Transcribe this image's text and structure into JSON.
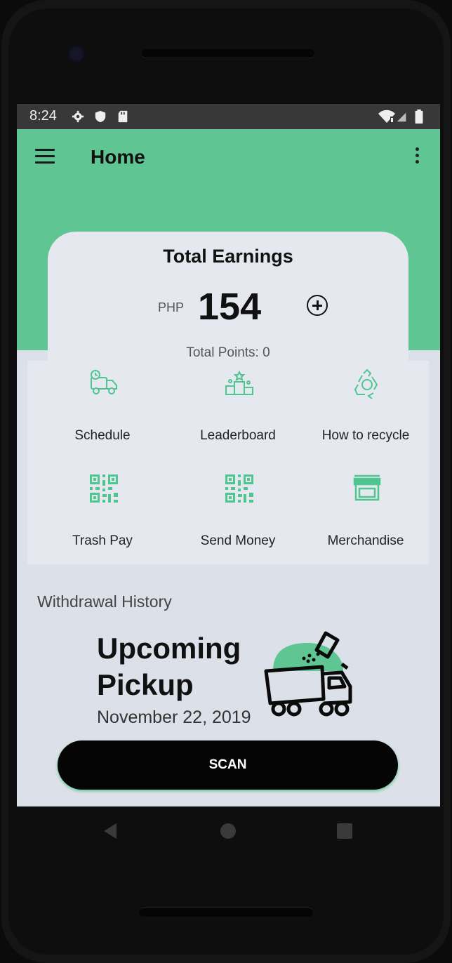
{
  "status_bar": {
    "time": "8:24"
  },
  "app_bar": {
    "title": "Home"
  },
  "earnings": {
    "title": "Total Earnings",
    "currency": "PHP",
    "amount": "154",
    "points": "Total Points: 0"
  },
  "actions": [
    {
      "label": "Schedule",
      "icon": "truck-icon"
    },
    {
      "label": "Leaderboard",
      "icon": "podium-icon"
    },
    {
      "label": "How to recycle",
      "icon": "recycle-icon"
    },
    {
      "label": "Trash Pay",
      "icon": "qr-code-icon"
    },
    {
      "label": "Send Money",
      "icon": "qr-code-icon"
    },
    {
      "label": "Merchandise",
      "icon": "store-icon"
    }
  ],
  "withdrawal_history": "Withdrawal History",
  "upcoming": {
    "line1": "Upcoming",
    "line2": "Pickup",
    "date": "November 22, 2019"
  },
  "scan_button": "SCAN",
  "colors": {
    "accent": "#5ec593",
    "background": "#dce0e8",
    "card": "#e6e8ef",
    "button": "#050505"
  }
}
